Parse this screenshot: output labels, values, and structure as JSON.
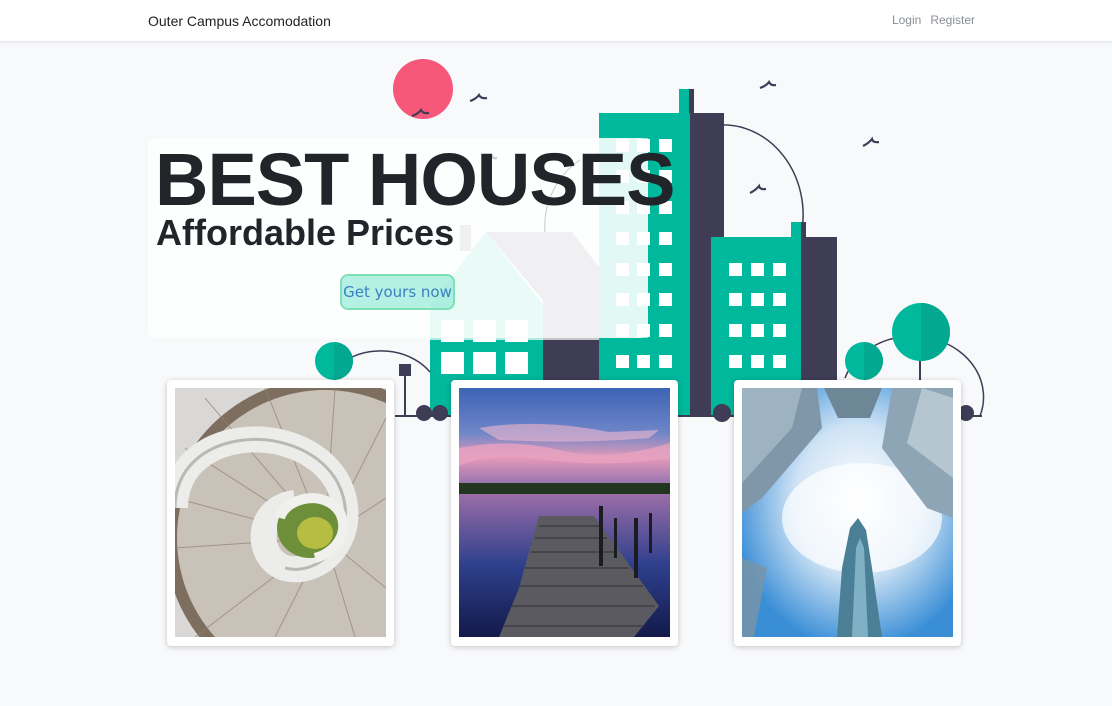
{
  "navbar": {
    "brand": "Outer Campus Accomodation",
    "links": [
      {
        "label": "Login"
      },
      {
        "label": "Register"
      }
    ]
  },
  "hero": {
    "title": "BEST HOUSES",
    "subtitle": "Affordable Prices",
    "cta_label": "Get yours now"
  },
  "cards": [
    {
      "image": "spiral-staircase-photo"
    },
    {
      "image": "lake-dock-sunset-photo"
    },
    {
      "image": "skyscrapers-sky-photo"
    }
  ],
  "colors": {
    "teal": "#00b89c",
    "dark_navy": "#3f3d56",
    "mint": "#b3ece1",
    "gray_house": "#c8c7d0",
    "pink_sun": "#f7587a",
    "background": "#f8f9fb"
  }
}
